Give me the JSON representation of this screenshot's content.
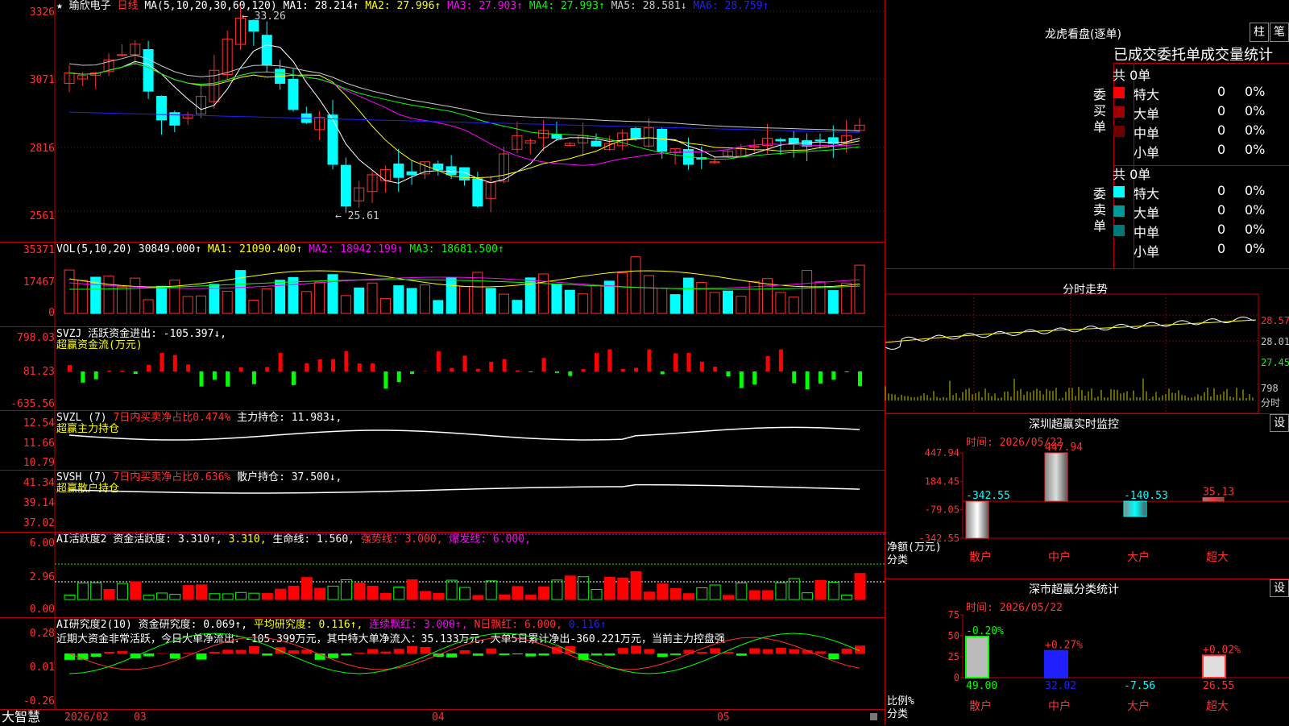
{
  "title": {
    "star": "★",
    "name": "瑜欣电子",
    "period": "日线",
    "ma_label": "MA(5,10,20,30,60,120)",
    "ma": [
      {
        "label": "MA1:",
        "value": "28.214↑",
        "color": "#ffffff"
      },
      {
        "label": "MA2:",
        "value": "27.996↑",
        "color": "#ffff00"
      },
      {
        "label": "MA3:",
        "value": "27.903↑",
        "color": "#ff00ff"
      },
      {
        "label": "MA4:",
        "value": "27.993↑",
        "color": "#00ff00"
      },
      {
        "label": "MA5:",
        "value": "28.581↓",
        "color": "#c8c8c8"
      },
      {
        "label": "MA6:",
        "value": "28.759↑",
        "color": "#2020ff"
      }
    ]
  },
  "price_axis": [
    "3326",
    "3071",
    "2816",
    "2561"
  ],
  "high_mark": "33.26",
  "low_mark": "25.61",
  "vol": {
    "label": "VOL(5,10,20)",
    "value": "30849.000↑",
    "ma": [
      {
        "t": "MA1:",
        "v": "21090.400↑",
        "c": "#ffff00"
      },
      {
        "t": "MA2:",
        "v": "18942.199↑",
        "c": "#ff00ff"
      },
      {
        "t": "MA3:",
        "v": "18681.500↑",
        "c": "#00ff00"
      }
    ],
    "axis": [
      "35371",
      "17467",
      "0"
    ]
  },
  "svzj": {
    "l1": "SVZJ  活跃资金进出: -105.397↓,",
    "l2": "超赢资金流(万元)",
    "axis": [
      "798.03",
      "81.23",
      "-635.56"
    ]
  },
  "svzl": {
    "l1a": "SVZL (7)",
    "l1b": "7日内买卖净占比0.474%",
    "l1c": "主力持仓: 11.983↓,",
    "l2": "超赢主力持仓",
    "axis": [
      "12.54",
      "11.66",
      "10.79"
    ]
  },
  "svsh": {
    "l1a": "SVSH (7)",
    "l1b": "7日内买卖净占比0.636%",
    "l1c": "散户持仓: 37.500↓,",
    "l2": "超赢散户持仓",
    "axis": [
      "41.34",
      "39.14",
      "37.02"
    ]
  },
  "ai1": {
    "l1": "AI活跃度2 资金活跃度: 3.310↑,",
    "l1y": "3.310,",
    "l1c": "生命线: 1.560,",
    "l1r": "强势线: 3.000,",
    "l1m": "爆发线: 6.000,",
    "axis": [
      "6.00",
      "2.96",
      "0.00"
    ]
  },
  "ai2": {
    "l1": "AI研究度2(10) 资金研究度: 0.069↑,",
    "l1y": "平均研究度: 0.116↑,",
    "l1m": "连续飘红: 3.000↑,",
    "l1g": "N日飘红: 6.000,",
    "l1b": "0.116↑",
    "l2": "近期大资金非常活跃，今日大单净流出：-105.399万元，其中特大单净流入：35.133万元，大单5日累计净出-360.221万元，当前主力控盘强",
    "axis": [
      "0.28",
      "0.01",
      "-0.26"
    ]
  },
  "bottom": {
    "brand": "大智慧",
    "dates": [
      "2026/02",
      "03",
      "04",
      "05"
    ]
  },
  "lhb": {
    "title": "龙虎看盘(逐单)",
    "btn1": "柱",
    "btn2": "笔",
    "header": "已成交委托单成交量统计",
    "buy": {
      "side": "委买单",
      "total": "共 0单",
      "rows": [
        {
          "n": "特大",
          "v": "0",
          "p": "0%",
          "c": "#ff0000"
        },
        {
          "n": "大单",
          "v": "0",
          "p": "0%",
          "c": "#a00000"
        },
        {
          "n": "中单",
          "v": "0",
          "p": "0%",
          "c": "#700000"
        },
        {
          "n": "小单",
          "v": "0",
          "p": "0%",
          "c": ""
        }
      ]
    },
    "sell": {
      "side": "委卖单",
      "total": "共 0单",
      "rows": [
        {
          "n": "特大",
          "v": "0",
          "p": "0%",
          "c": "#00ffff"
        },
        {
          "n": "大单",
          "v": "0",
          "p": "0%",
          "c": "#009999"
        },
        {
          "n": "中单",
          "v": "0",
          "p": "0%",
          "c": "#007777"
        },
        {
          "n": "小单",
          "v": "0",
          "p": "0%",
          "c": ""
        }
      ]
    }
  },
  "fenshi": {
    "title": "分时走势",
    "axis": [
      "28.57",
      "28.01",
      "27.45"
    ],
    "vol_axis": [
      "798",
      "分时"
    ]
  },
  "sz": {
    "title": "深圳超赢实时监控",
    "btn": "设",
    "time": "时间: 2026/05/22",
    "axis": [
      "447.94",
      "184.45",
      "-79.05",
      "-342.55"
    ],
    "ylabel": [
      "净额(万元)",
      "分类"
    ],
    "cats": [
      "散户",
      "中户",
      "大户",
      "超大"
    ],
    "values": [
      "-342.55",
      "447.94",
      "-140.53",
      "35.13"
    ]
  },
  "cls": {
    "title": "深市超赢分类统计",
    "btn": "设",
    "time": "时间: 2026/05/22",
    "axis": [
      "75",
      "50",
      "25",
      "0"
    ],
    "ylabel": [
      "比例%",
      "分类"
    ],
    "cats": [
      "散户",
      "中户",
      "大户",
      "超大"
    ],
    "top": [
      "-0.20%",
      "+0.27%",
      "",
      "+0.02%"
    ],
    "bottom": [
      "49.00",
      "32.02",
      "-7.56",
      "26.55"
    ]
  }
}
